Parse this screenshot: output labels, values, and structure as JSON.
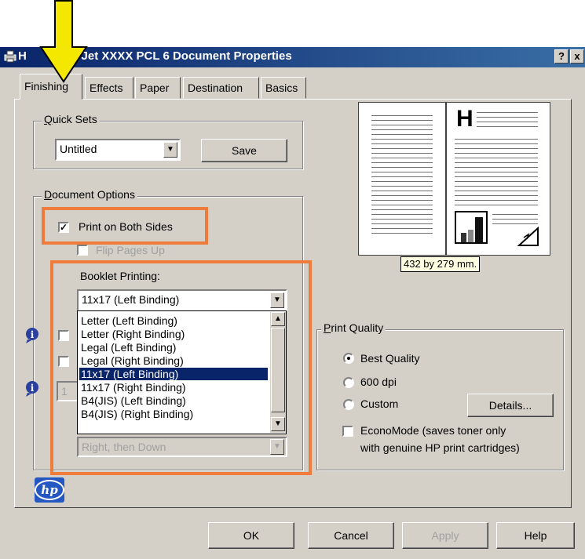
{
  "window": {
    "title_prefix": "H",
    "title": "serJet XXXX PCL 6 Document Properties",
    "help_btn": "?",
    "close_btn": "x"
  },
  "tabs": [
    "Finishing",
    "Effects",
    "Paper",
    "Destination",
    "Basics"
  ],
  "quick_sets": {
    "legend": "Quick Sets",
    "value": "Untitled",
    "save_label": "Save"
  },
  "document_options": {
    "legend": "Document Options",
    "print_both_sides": "Print on Both Sides",
    "print_both_sides_checked": true,
    "flip_pages_up": "Flip Pages Up",
    "booklet_label": "Booklet Printing:",
    "booklet_value": "11x17 (Left Binding)",
    "booklet_options": [
      "Letter (Left Binding)",
      "Letter (Right Binding)",
      "Legal (Left Binding)",
      "Legal (Right Binding)",
      "11x17 (Left Binding)",
      "11x17 (Right Binding)",
      "B4(JIS) (Left Binding)",
      "B4(JIS) (Right Binding)"
    ],
    "selected_index": 4,
    "page_order_value": "Right, then Down",
    "pages_per_sheet_value": "1"
  },
  "preview": {
    "dimension_label": "432 by 279 mm.",
    "letter": "H"
  },
  "print_quality": {
    "legend": "Print Quality",
    "options": [
      "Best Quality",
      "600 dpi",
      "Custom"
    ],
    "selected": "Best Quality",
    "details_label": "Details...",
    "economode_line1": "EconoMode (saves toner only",
    "economode_line2": "with genuine HP print cartridges)"
  },
  "logo": {
    "text": "hp"
  },
  "footer": {
    "ok": "OK",
    "cancel": "Cancel",
    "apply": "Apply",
    "help": "Help"
  },
  "annotation_colors": {
    "arrow": "#f5e800",
    "highlight_box": "#ef7c3a",
    "selection": "#0a246a"
  }
}
